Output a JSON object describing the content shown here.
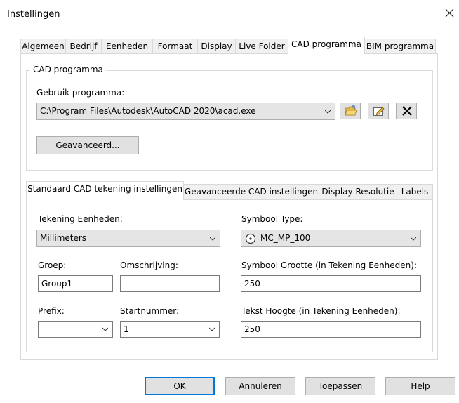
{
  "window": {
    "title": "Instellingen"
  },
  "tabs": [
    {
      "label": "Algemeen"
    },
    {
      "label": "Bedrijf"
    },
    {
      "label": "Eenheden"
    },
    {
      "label": "Formaat"
    },
    {
      "label": "Display"
    },
    {
      "label": "Live Folder"
    },
    {
      "label": "CAD programma"
    },
    {
      "label": "BIM programma"
    }
  ],
  "active_tab": "CAD programma",
  "cad_group": {
    "legend": "CAD programma",
    "program_label": "Gebruik programma:",
    "program_value": "C:\\Program Files\\Autodesk\\AutoCAD 2020\\acad.exe",
    "advanced_button": "Geavanceerd...",
    "icons": [
      "open-folder-icon",
      "edit-icon",
      "delete-icon"
    ]
  },
  "subtabs": [
    {
      "label": "Standaard CAD tekening instellingen"
    },
    {
      "label": "Geavanceerde CAD instellingen"
    },
    {
      "label": "Display Resolutie"
    },
    {
      "label": "Labels"
    }
  ],
  "form": {
    "units_label": "Tekening Eenheden:",
    "units_value": "Millimeters",
    "group_label": "Groep:",
    "group_value": "Group1",
    "desc_label": "Omschrijving:",
    "desc_value": "",
    "prefix_label": "Prefix:",
    "prefix_value": "",
    "start_label": "Startnummer:",
    "start_value": "1",
    "symbol_type_label": "Symbool Type:",
    "symbol_type_value": "MC_MP_100",
    "symbol_size_label": "Symbool Grootte (in Tekening Eenheden):",
    "symbol_size_value": "250",
    "text_height_label": "Tekst Hoogte (in Tekening Eenheden):",
    "text_height_value": "250"
  },
  "footer": {
    "ok": "OK",
    "cancel": "Annuleren",
    "apply": "Toepassen",
    "help": "Help"
  }
}
